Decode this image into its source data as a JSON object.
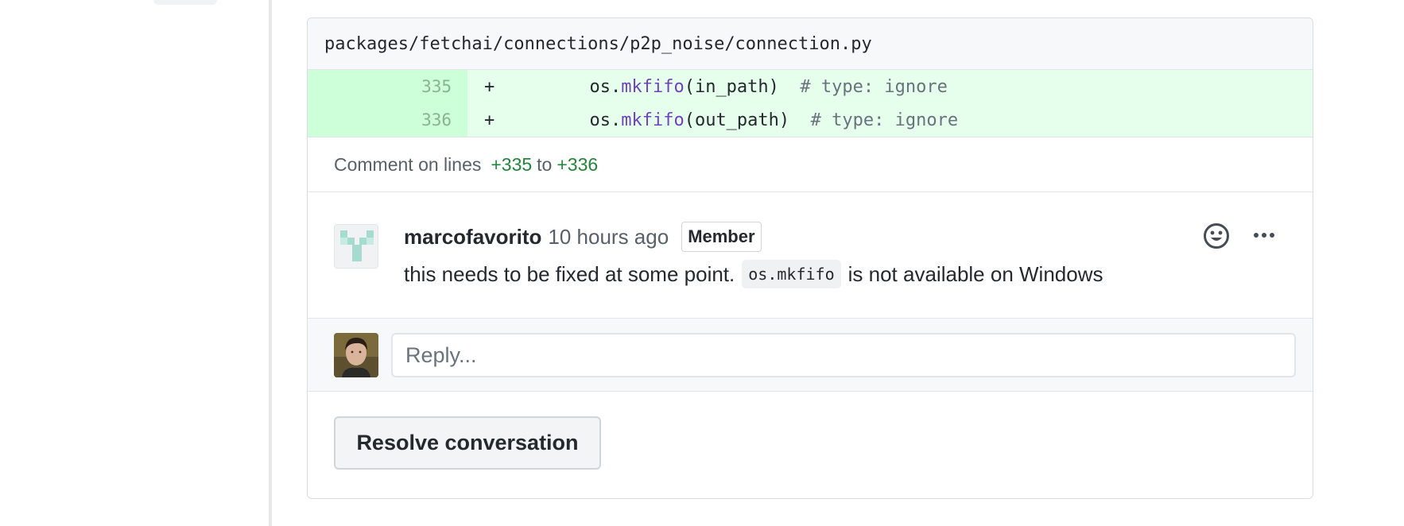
{
  "thread": {
    "file_path": "packages/fetchai/connections/p2p_noise/connection.py",
    "diff_lines": [
      {
        "number": "335",
        "marker": "+",
        "indent": "         ",
        "obj": "os.",
        "fn": "mkfifo",
        "args": "(in_path)",
        "comment": "  # type: ignore"
      },
      {
        "number": "336",
        "marker": "+",
        "indent": "         ",
        "obj": "os.",
        "fn": "mkfifo",
        "args": "(out_path)",
        "comment": "  # type: ignore"
      }
    ],
    "range": {
      "prefix": "Comment on lines",
      "start": "+335",
      "middle": "to",
      "end": "+336"
    }
  },
  "comment": {
    "author": "marcofavorito",
    "timestamp": "10 hours ago",
    "badge": "Member",
    "body_before": "this needs to be fixed at some point.",
    "body_code": "os.mkfifo",
    "body_after": "is not available on Windows",
    "emoji_icon": "smiley-icon",
    "more_icon": "kebab-horizontal-icon"
  },
  "reply": {
    "placeholder": "Reply..."
  },
  "actions": {
    "resolve_label": "Resolve conversation"
  },
  "colors": {
    "addition_line_bg": "#e6ffec",
    "addition_num_bg": "#cdffd8",
    "function_token": "#6f42c1",
    "range_number": "#22863a"
  }
}
